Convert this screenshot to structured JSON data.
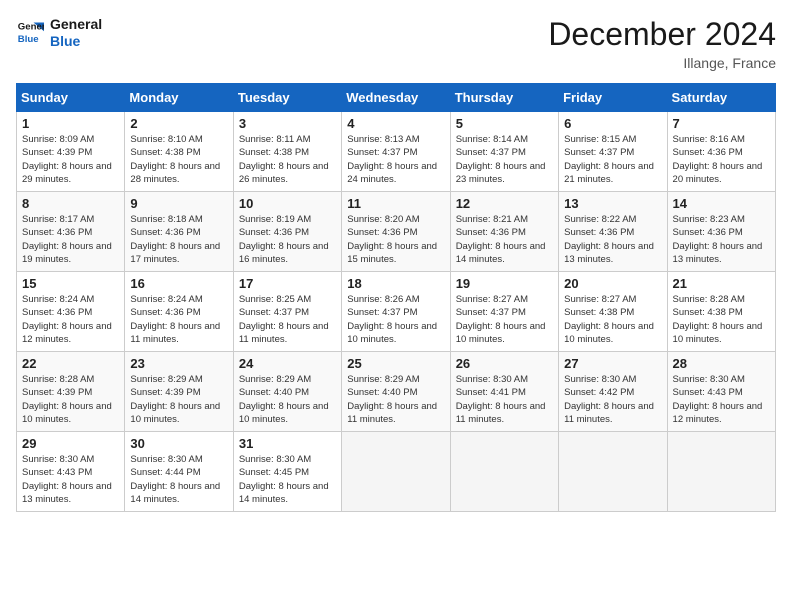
{
  "header": {
    "logo_line1": "General",
    "logo_line2": "Blue",
    "month_title": "December 2024",
    "location": "Illange, France"
  },
  "weekdays": [
    "Sunday",
    "Monday",
    "Tuesday",
    "Wednesday",
    "Thursday",
    "Friday",
    "Saturday"
  ],
  "weeks": [
    [
      {
        "day": "1",
        "sunrise": "Sunrise: 8:09 AM",
        "sunset": "Sunset: 4:39 PM",
        "daylight": "Daylight: 8 hours and 29 minutes."
      },
      {
        "day": "2",
        "sunrise": "Sunrise: 8:10 AM",
        "sunset": "Sunset: 4:38 PM",
        "daylight": "Daylight: 8 hours and 28 minutes."
      },
      {
        "day": "3",
        "sunrise": "Sunrise: 8:11 AM",
        "sunset": "Sunset: 4:38 PM",
        "daylight": "Daylight: 8 hours and 26 minutes."
      },
      {
        "day": "4",
        "sunrise": "Sunrise: 8:13 AM",
        "sunset": "Sunset: 4:37 PM",
        "daylight": "Daylight: 8 hours and 24 minutes."
      },
      {
        "day": "5",
        "sunrise": "Sunrise: 8:14 AM",
        "sunset": "Sunset: 4:37 PM",
        "daylight": "Daylight: 8 hours and 23 minutes."
      },
      {
        "day": "6",
        "sunrise": "Sunrise: 8:15 AM",
        "sunset": "Sunset: 4:37 PM",
        "daylight": "Daylight: 8 hours and 21 minutes."
      },
      {
        "day": "7",
        "sunrise": "Sunrise: 8:16 AM",
        "sunset": "Sunset: 4:36 PM",
        "daylight": "Daylight: 8 hours and 20 minutes."
      }
    ],
    [
      {
        "day": "8",
        "sunrise": "Sunrise: 8:17 AM",
        "sunset": "Sunset: 4:36 PM",
        "daylight": "Daylight: 8 hours and 19 minutes."
      },
      {
        "day": "9",
        "sunrise": "Sunrise: 8:18 AM",
        "sunset": "Sunset: 4:36 PM",
        "daylight": "Daylight: 8 hours and 17 minutes."
      },
      {
        "day": "10",
        "sunrise": "Sunrise: 8:19 AM",
        "sunset": "Sunset: 4:36 PM",
        "daylight": "Daylight: 8 hours and 16 minutes."
      },
      {
        "day": "11",
        "sunrise": "Sunrise: 8:20 AM",
        "sunset": "Sunset: 4:36 PM",
        "daylight": "Daylight: 8 hours and 15 minutes."
      },
      {
        "day": "12",
        "sunrise": "Sunrise: 8:21 AM",
        "sunset": "Sunset: 4:36 PM",
        "daylight": "Daylight: 8 hours and 14 minutes."
      },
      {
        "day": "13",
        "sunrise": "Sunrise: 8:22 AM",
        "sunset": "Sunset: 4:36 PM",
        "daylight": "Daylight: 8 hours and 13 minutes."
      },
      {
        "day": "14",
        "sunrise": "Sunrise: 8:23 AM",
        "sunset": "Sunset: 4:36 PM",
        "daylight": "Daylight: 8 hours and 13 minutes."
      }
    ],
    [
      {
        "day": "15",
        "sunrise": "Sunrise: 8:24 AM",
        "sunset": "Sunset: 4:36 PM",
        "daylight": "Daylight: 8 hours and 12 minutes."
      },
      {
        "day": "16",
        "sunrise": "Sunrise: 8:24 AM",
        "sunset": "Sunset: 4:36 PM",
        "daylight": "Daylight: 8 hours and 11 minutes."
      },
      {
        "day": "17",
        "sunrise": "Sunrise: 8:25 AM",
        "sunset": "Sunset: 4:37 PM",
        "daylight": "Daylight: 8 hours and 11 minutes."
      },
      {
        "day": "18",
        "sunrise": "Sunrise: 8:26 AM",
        "sunset": "Sunset: 4:37 PM",
        "daylight": "Daylight: 8 hours and 10 minutes."
      },
      {
        "day": "19",
        "sunrise": "Sunrise: 8:27 AM",
        "sunset": "Sunset: 4:37 PM",
        "daylight": "Daylight: 8 hours and 10 minutes."
      },
      {
        "day": "20",
        "sunrise": "Sunrise: 8:27 AM",
        "sunset": "Sunset: 4:38 PM",
        "daylight": "Daylight: 8 hours and 10 minutes."
      },
      {
        "day": "21",
        "sunrise": "Sunrise: 8:28 AM",
        "sunset": "Sunset: 4:38 PM",
        "daylight": "Daylight: 8 hours and 10 minutes."
      }
    ],
    [
      {
        "day": "22",
        "sunrise": "Sunrise: 8:28 AM",
        "sunset": "Sunset: 4:39 PM",
        "daylight": "Daylight: 8 hours and 10 minutes."
      },
      {
        "day": "23",
        "sunrise": "Sunrise: 8:29 AM",
        "sunset": "Sunset: 4:39 PM",
        "daylight": "Daylight: 8 hours and 10 minutes."
      },
      {
        "day": "24",
        "sunrise": "Sunrise: 8:29 AM",
        "sunset": "Sunset: 4:40 PM",
        "daylight": "Daylight: 8 hours and 10 minutes."
      },
      {
        "day": "25",
        "sunrise": "Sunrise: 8:29 AM",
        "sunset": "Sunset: 4:40 PM",
        "daylight": "Daylight: 8 hours and 11 minutes."
      },
      {
        "day": "26",
        "sunrise": "Sunrise: 8:30 AM",
        "sunset": "Sunset: 4:41 PM",
        "daylight": "Daylight: 8 hours and 11 minutes."
      },
      {
        "day": "27",
        "sunrise": "Sunrise: 8:30 AM",
        "sunset": "Sunset: 4:42 PM",
        "daylight": "Daylight: 8 hours and 11 minutes."
      },
      {
        "day": "28",
        "sunrise": "Sunrise: 8:30 AM",
        "sunset": "Sunset: 4:43 PM",
        "daylight": "Daylight: 8 hours and 12 minutes."
      }
    ],
    [
      {
        "day": "29",
        "sunrise": "Sunrise: 8:30 AM",
        "sunset": "Sunset: 4:43 PM",
        "daylight": "Daylight: 8 hours and 13 minutes."
      },
      {
        "day": "30",
        "sunrise": "Sunrise: 8:30 AM",
        "sunset": "Sunset: 4:44 PM",
        "daylight": "Daylight: 8 hours and 14 minutes."
      },
      {
        "day": "31",
        "sunrise": "Sunrise: 8:30 AM",
        "sunset": "Sunset: 4:45 PM",
        "daylight": "Daylight: 8 hours and 14 minutes."
      },
      null,
      null,
      null,
      null
    ]
  ]
}
